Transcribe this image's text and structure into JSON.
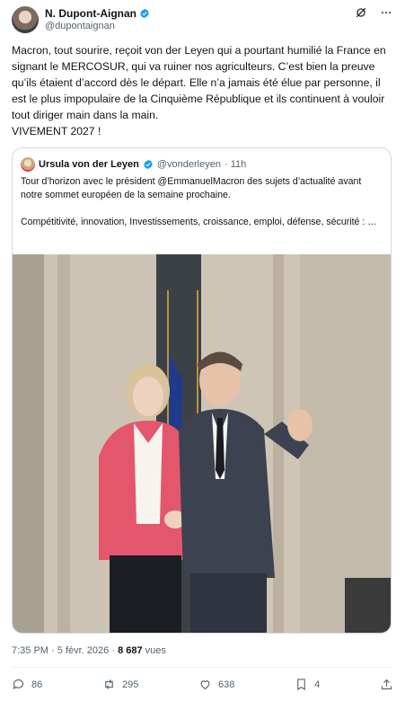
{
  "author": {
    "name": "N. Dupont-Aignan",
    "handle": "@dupontaignan"
  },
  "tweet_text": [
    "Macron, tout sourire, reçoit von der Leyen qui a pourtant humilié la France en signant le MERCOSUR, qui va ruiner nos agriculteurs. C’est bien la preuve qu’ils étaient d’accord dès le départ. Elle n’a jamais été élue par personne, il est le plus impopulaire de la Cinquième République et ils continuent à vouloir tout diriger main dans la main.",
    "VIVEMENT 2027 !"
  ],
  "quote": {
    "name": "Ursula von der Leyen",
    "handle": "@vonderleyen",
    "time": "· 11h",
    "text": [
      "Tour d’horizon avec le président @EmmanuelMacron des sujets d’actualité avant notre sommet européen de la semaine prochaine.",
      "Compétitivité, innovation, Investissements, croissance, emploi, défense, sécurité : …"
    ]
  },
  "meta": {
    "time": "7:35 PM",
    "date": "5 févr. 2026",
    "views": "8 687",
    "views_label": "vues"
  },
  "actions": {
    "replies": "86",
    "reposts": "295",
    "likes": "638",
    "bookmarks": "4"
  },
  "colors": {
    "verified": "#1d9bf0",
    "secondary_text": "#536471",
    "border": "#cfd9de"
  },
  "icons": [
    "verified-badge-icon",
    "grok-icon",
    "more-icon",
    "reply-icon",
    "repost-icon",
    "like-icon",
    "bookmark-icon",
    "share-icon"
  ]
}
